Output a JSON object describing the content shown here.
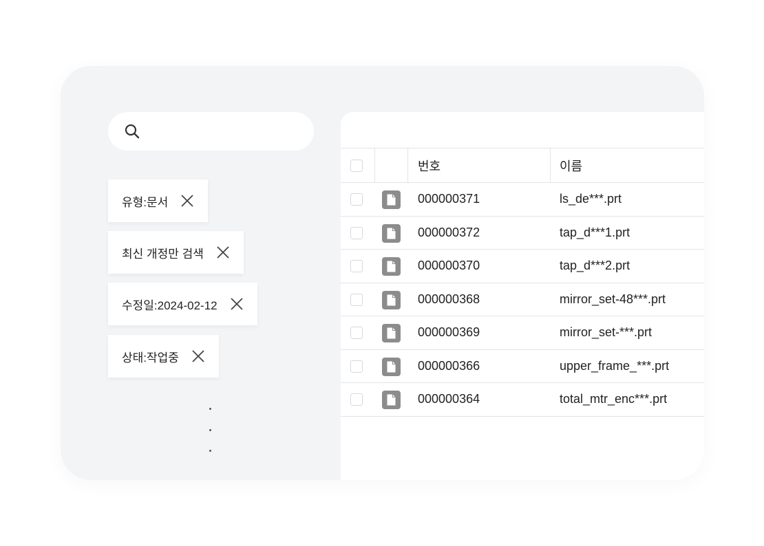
{
  "filters": [
    {
      "label": "유형:문서"
    },
    {
      "label": "최신 개정만 검색"
    },
    {
      "label": "수정일:2024-02-12"
    },
    {
      "label": "상태:작업중"
    }
  ],
  "table": {
    "columns": [
      "번호",
      "이름"
    ],
    "rows": [
      {
        "number": "000000371",
        "name": "ls_de***.prt"
      },
      {
        "number": "000000372",
        "name": "tap_d***1.prt"
      },
      {
        "number": "000000370",
        "name": "tap_d***2.prt"
      },
      {
        "number": "000000368",
        "name": "mirror_set-48***.prt"
      },
      {
        "number": "000000369",
        "name": "mirror_set-***.prt"
      },
      {
        "number": "000000366",
        "name": "upper_frame_***.prt"
      },
      {
        "number": "000000364",
        "name": "total_mtr_enc***.prt"
      }
    ]
  },
  "colors": {
    "background": "#f3f4f6",
    "file_icon": "#8c8c8c"
  }
}
